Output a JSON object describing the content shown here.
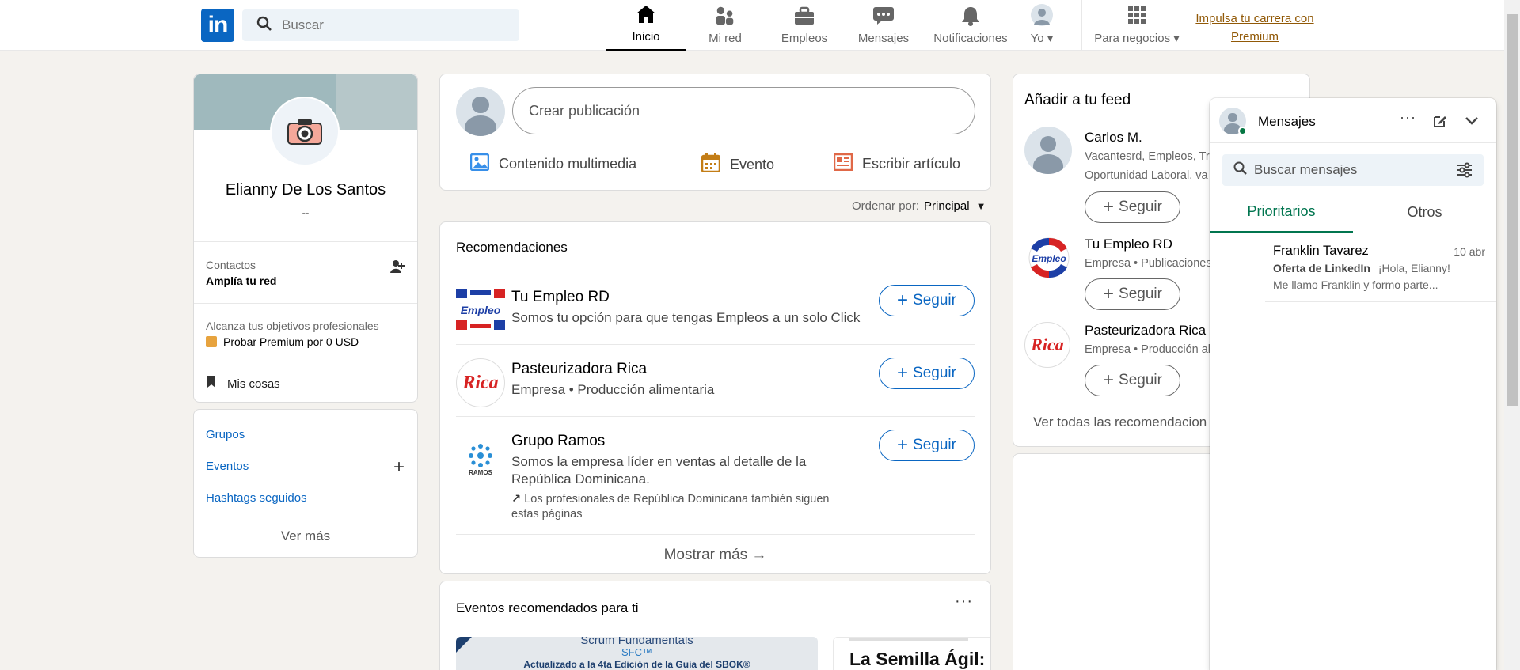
{
  "brand": {
    "logo_text": "in",
    "color": "#0a66c2"
  },
  "search": {
    "placeholder": "Buscar"
  },
  "nav": {
    "items": [
      {
        "label": "Inicio",
        "icon": "home-icon",
        "active": true
      },
      {
        "label": "Mi red",
        "icon": "network-icon"
      },
      {
        "label": "Empleos",
        "icon": "briefcase-icon"
      },
      {
        "label": "Mensajes",
        "icon": "chat-icon"
      },
      {
        "label": "Notificaciones",
        "icon": "bell-icon"
      },
      {
        "label": "Yo",
        "icon": "avatar-icon"
      },
      {
        "label": "Para negocios",
        "icon": "grid-icon"
      }
    ],
    "premium_line1": "Impulsa tu carrera con",
    "premium_line2": "Premium"
  },
  "profile": {
    "name": "Elianny De Los Santos",
    "headline": "--",
    "contacts_label": "Contactos",
    "contacts_sub": "Amplía tu red",
    "goals_label": "Alcanza tus objetivos profesionales",
    "premium_try": "Probar Premium por 0 USD",
    "my_items": "Mis cosas"
  },
  "community": {
    "groups": "Grupos",
    "events": "Eventos",
    "hashtags": "Hashtags seguidos",
    "see_more": "Ver más"
  },
  "composer": {
    "placeholder": "Crear publicación",
    "media": "Contenido multimedia",
    "event": "Evento",
    "article": "Escribir artículo"
  },
  "sort": {
    "label": "Ordenar por:",
    "value": "Principal"
  },
  "recommendations": {
    "title": "Recomendaciones",
    "follow_label": "Seguir",
    "items": [
      {
        "name": "Tu Empleo RD",
        "desc": "Somos tu opción para que tengas Empleos a un solo Click"
      },
      {
        "name": "Pasteurizadora Rica",
        "desc": "Empresa • Producción alimentaria"
      },
      {
        "name": "Grupo Ramos",
        "desc": "Somos la empresa líder en ventas al detalle de la República Dominicana.",
        "note": "Los profesionales de República Dominicana también siguen estas páginas",
        "logo_text": "RAMOS"
      }
    ],
    "show_more": "Mostrar más →"
  },
  "events": {
    "title": "Eventos recomendados para ti",
    "card1_line1": "Scrum Fundamentals",
    "card1_line2": "SFC™",
    "card1_line3": "Actualizado a la 4ta Edición de la Guía del SBOK®",
    "card2_line1": "La Semilla Ágil:"
  },
  "feed": {
    "title": "Añadir a tu feed",
    "follow_label": "Seguir",
    "items": [
      {
        "name": "Carlos M.",
        "desc1": "Vacantesrd, Empleos, Tra",
        "desc2": "Oportunidad Laboral, va"
      },
      {
        "name": "Tu Empleo RD",
        "desc1": "Empresa • Publicaciones"
      },
      {
        "name": "Pasteurizadora Rica",
        "desc1": "Empresa • Producción al"
      }
    ],
    "see_all": "Ver todas las recomendacion"
  },
  "messages": {
    "title": "Mensajes",
    "search_placeholder": "Buscar mensajes",
    "tab_focused": "Prioritarios",
    "tab_other": "Otros",
    "conversations": [
      {
        "sender": "Franklin Tavarez",
        "date": "10 abr",
        "tag": "Oferta de LinkedIn",
        "preview1": "¡Hola, Elianny!",
        "preview2": "Me llamo Franklin y formo parte..."
      }
    ]
  }
}
